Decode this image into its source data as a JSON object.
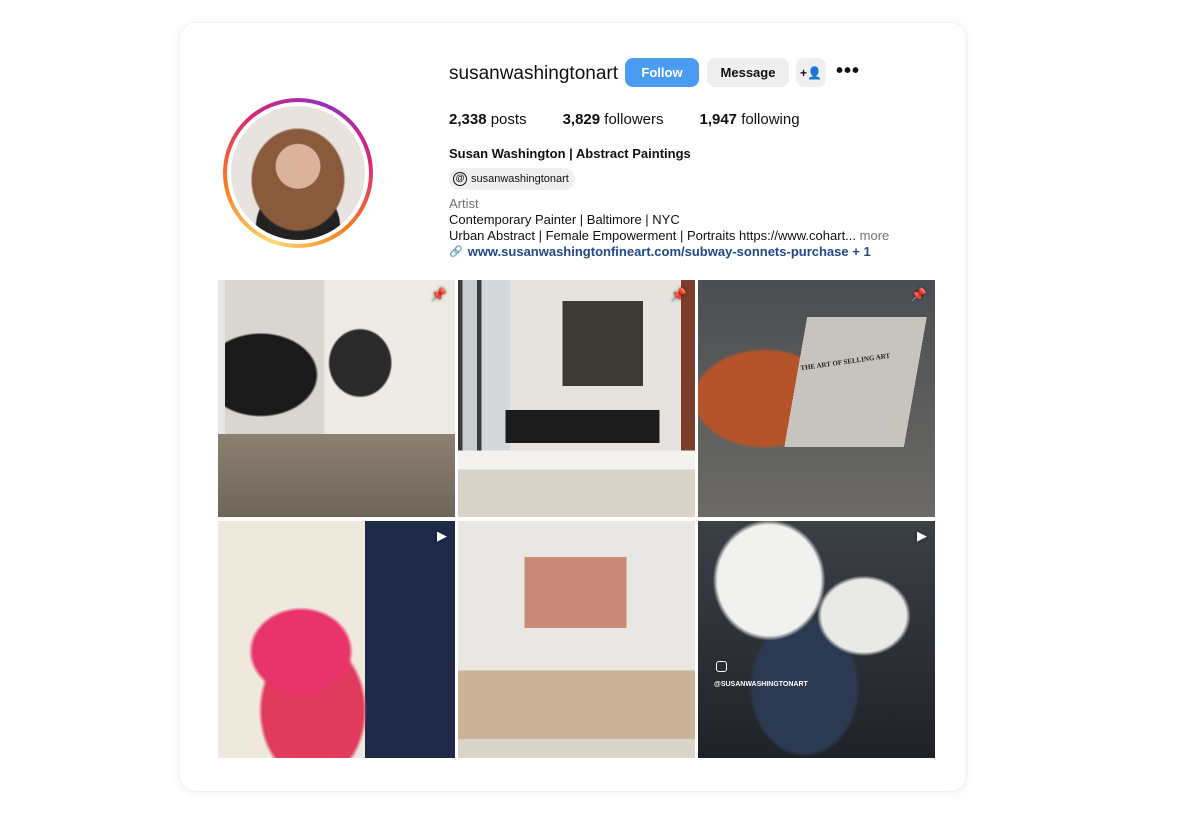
{
  "profile": {
    "username": "susanwashingtonart",
    "full_name": "Susan Washington | Abstract Paintings",
    "threads_handle": "susanwashingtonart",
    "category": "Artist",
    "bio_line1": "Contemporary Painter | Baltimore | NYC",
    "bio_line2": "Urban Abstract | Female Empowerment | Portraits https://www.cohart...",
    "bio_more": "more",
    "link": "www.susanwashingtonfineart.com/subway-sonnets-purchase + 1"
  },
  "actions": {
    "follow": "Follow",
    "message": "Message",
    "add_user_icon": "+👤",
    "more_icon": "•••"
  },
  "stats": {
    "posts_count": "2,338",
    "posts_label": "posts",
    "followers_count": "3,829",
    "followers_label": "followers",
    "following_count": "1,947",
    "following_label": "following"
  },
  "grid": {
    "tiles": [
      {
        "badge": "pin-icon"
      },
      {
        "badge": "pin-icon"
      },
      {
        "badge": "pin-icon",
        "book_title": "THE ART OF SELLING ART"
      },
      {
        "badge": "reels-icon"
      },
      {
        "badge": ""
      },
      {
        "badge": "reels-icon",
        "caption": "@SUSANWASHINGTONART"
      }
    ]
  }
}
